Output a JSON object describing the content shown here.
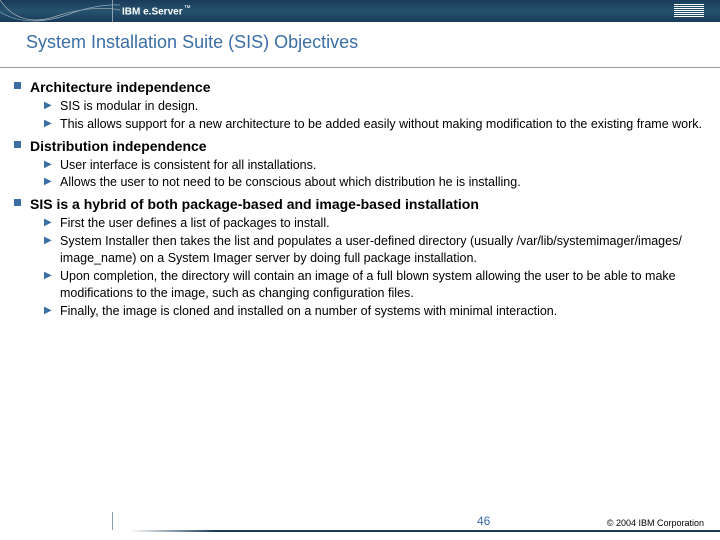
{
  "header": {
    "wordmark_prefix": "IBM e.",
    "wordmark_suffix": "Server",
    "trademark": "™"
  },
  "title": "System Installation Suite (SIS) Objectives",
  "sections": [
    {
      "heading": "Architecture independence",
      "items": [
        "SIS is modular in design.",
        "This allows support for a new architecture to be added easily without making modification to the existing frame work."
      ]
    },
    {
      "heading": "Distribution independence",
      "items": [
        "User interface is consistent for all installations.",
        "Allows the user to not need to be conscious about which distribution he is installing."
      ]
    },
    {
      "heading": "SIS is a hybrid of both package-based and image-based installation",
      "items": [
        "First the user defines a list of packages to install.",
        "System Installer then takes the list and populates a user-defined directory (usually /var/lib/systemimager/images/ image_name) on a System Imager server by doing full package installation.",
        "Upon completion, the directory will contain an image of a full blown system allowing the user to be able to make modifications to the image, such as changing configuration files.",
        "Finally, the image is cloned and installed on a number of systems with minimal interaction."
      ]
    }
  ],
  "footer": {
    "page_number": "46",
    "copyright": "© 2004 IBM Corporation"
  }
}
